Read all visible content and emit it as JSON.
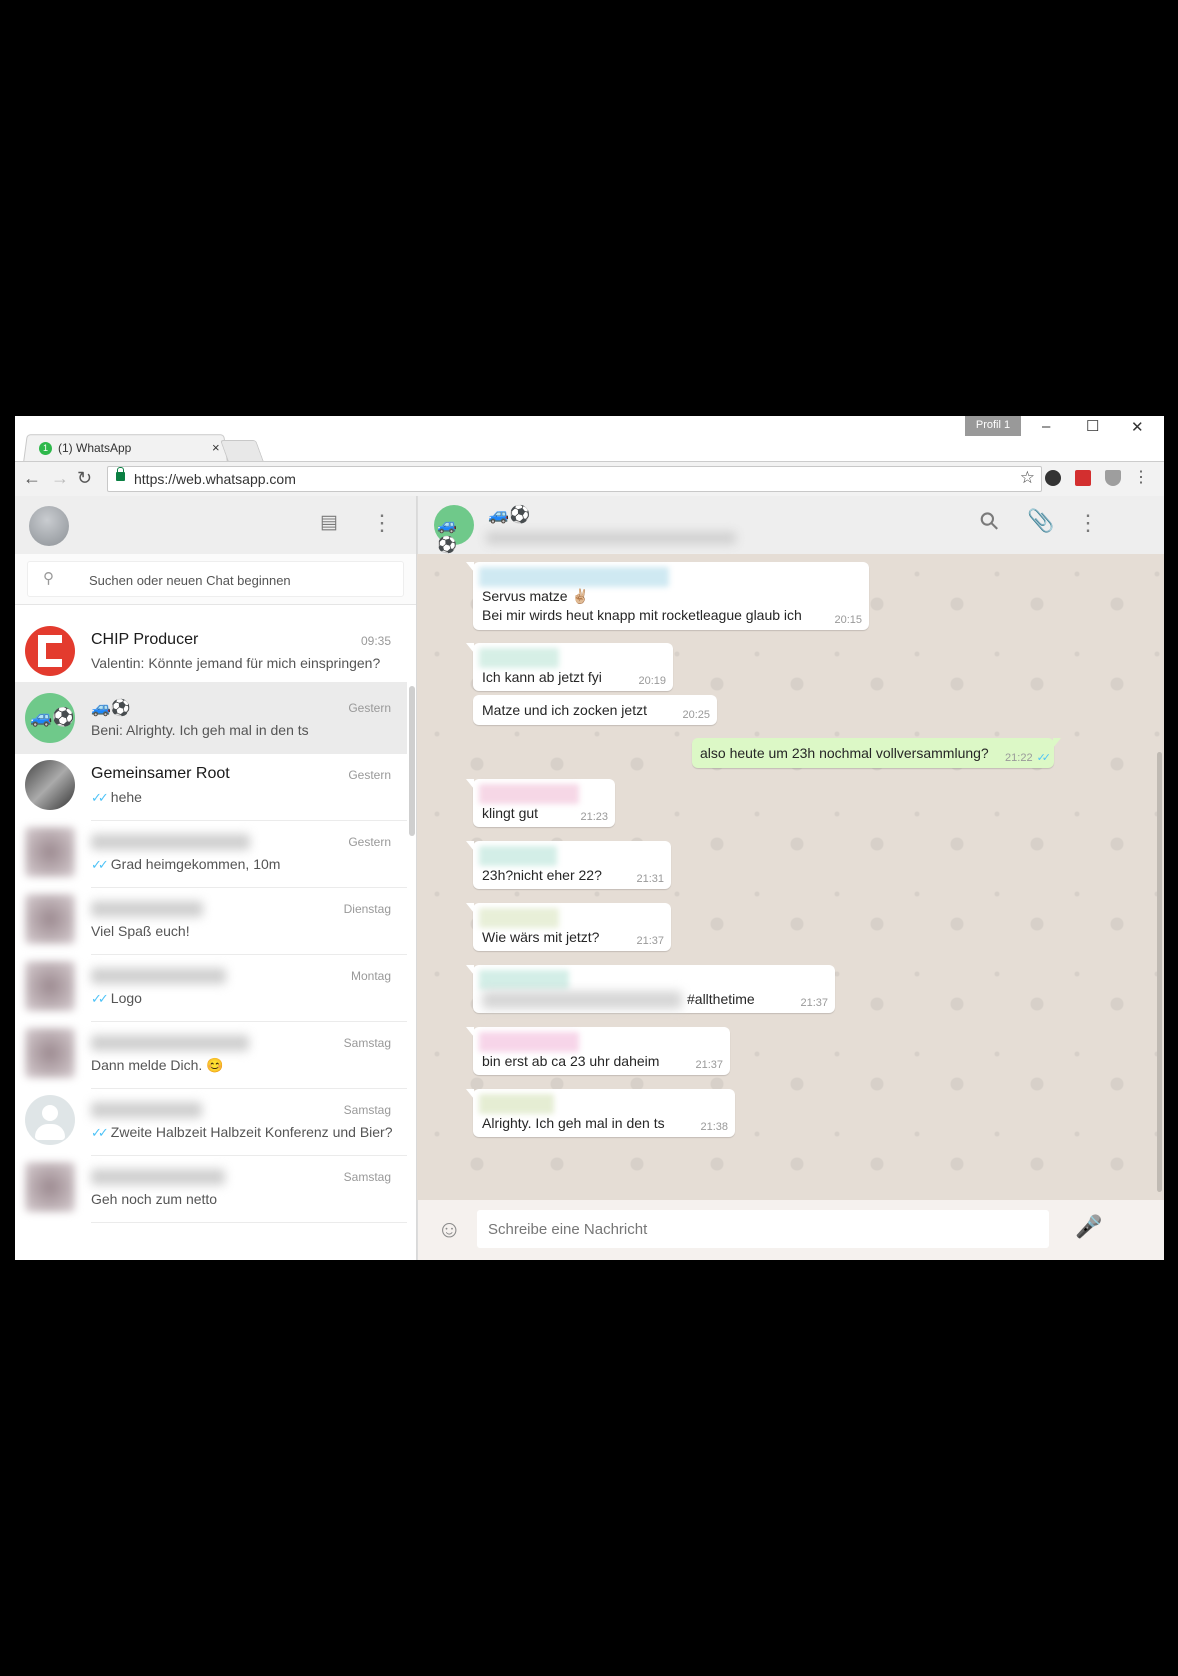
{
  "browser": {
    "tab_badge": "1",
    "tab_title": "(1) WhatsApp",
    "tab_close": "×",
    "profile_label": "Profil 1",
    "url": "https://web.whatsapp.com"
  },
  "left": {
    "search_placeholder": "Suchen oder neuen Chat beginnen",
    "chats": [
      {
        "name": "CHIP Producer",
        "time": "09:35",
        "last": "Valentin: Könnte jemand für mich einspringen?",
        "ticks": false,
        "avatar": "chip-logo",
        "active": false
      },
      {
        "name": "🚙⚽",
        "time": "Gestern",
        "last": "Beni: Alrighty. Ich geh mal in den ts",
        "ticks": false,
        "avatar": "group-emoji",
        "active": true
      },
      {
        "name": "Gemeinsamer Root",
        "time": "Gestern",
        "last": "hehe",
        "ticks": true,
        "avatar": "photo",
        "active": false
      },
      {
        "name": "",
        "time": "Gestern",
        "last": "Grad heimgekommen, 10m",
        "ticks": true,
        "avatar": "blurred",
        "active": false
      },
      {
        "name": "",
        "time": "Dienstag",
        "last": "Viel Spaß euch!",
        "ticks": false,
        "avatar": "blurred",
        "active": false
      },
      {
        "name": "",
        "time": "Montag",
        "last": "Logo",
        "ticks": true,
        "avatar": "blurred",
        "active": false
      },
      {
        "name": "",
        "time": "Samstag",
        "last": "Dann melde Dich. 😊",
        "ticks": false,
        "avatar": "blurred",
        "active": false
      },
      {
        "name": "",
        "time": "Samstag",
        "last": "Zweite Halbzeit Halbzeit Konferenz und Bier?",
        "ticks": true,
        "avatar": "default",
        "active": false
      },
      {
        "name": "",
        "time": "Samstag",
        "last": "Geh noch zum netto",
        "ticks": false,
        "avatar": "blurred",
        "active": false
      }
    ]
  },
  "chat": {
    "title": "🚙⚽",
    "messages": [
      {
        "dir": "in",
        "lines": [
          "Servus matze ✌🏼",
          "Bei mir wirds heut knapp mit rocketleague glaub ich"
        ],
        "time": "20:15"
      },
      {
        "dir": "in",
        "lines": [
          "Ich kann ab jetzt fyi"
        ],
        "time": "20:19"
      },
      {
        "dir": "in",
        "lines": [
          "Matze und ich zocken jetzt"
        ],
        "time": "20:25"
      },
      {
        "dir": "out",
        "lines": [
          "also heute um 23h nochmal vollversammlung?"
        ],
        "time": "21:22",
        "ticks": "✓✓"
      },
      {
        "dir": "in",
        "lines": [
          "klingt gut"
        ],
        "time": "21:23"
      },
      {
        "dir": "in",
        "lines": [
          "23h?nicht eher 22?"
        ],
        "time": "21:31"
      },
      {
        "dir": "in",
        "lines": [
          "Wie wärs mit jetzt?"
        ],
        "time": "21:37"
      },
      {
        "dir": "in",
        "lines": [
          "#allthetime"
        ],
        "time": "21:37"
      },
      {
        "dir": "in",
        "lines": [
          "bin erst ab ca 23 uhr daheim"
        ],
        "time": "21:37"
      },
      {
        "dir": "in",
        "lines": [
          "Alrighty. Ich geh mal in den ts"
        ],
        "time": "21:38"
      }
    ],
    "compose_placeholder": "Schreibe eine Nachricht"
  },
  "icons": [
    "back-icon",
    "forward-icon",
    "reload-icon",
    "lock-icon",
    "star-icon",
    "new-chat-icon",
    "menu-icon",
    "search-icon",
    "attach-icon",
    "emoji-icon",
    "mic-icon"
  ]
}
